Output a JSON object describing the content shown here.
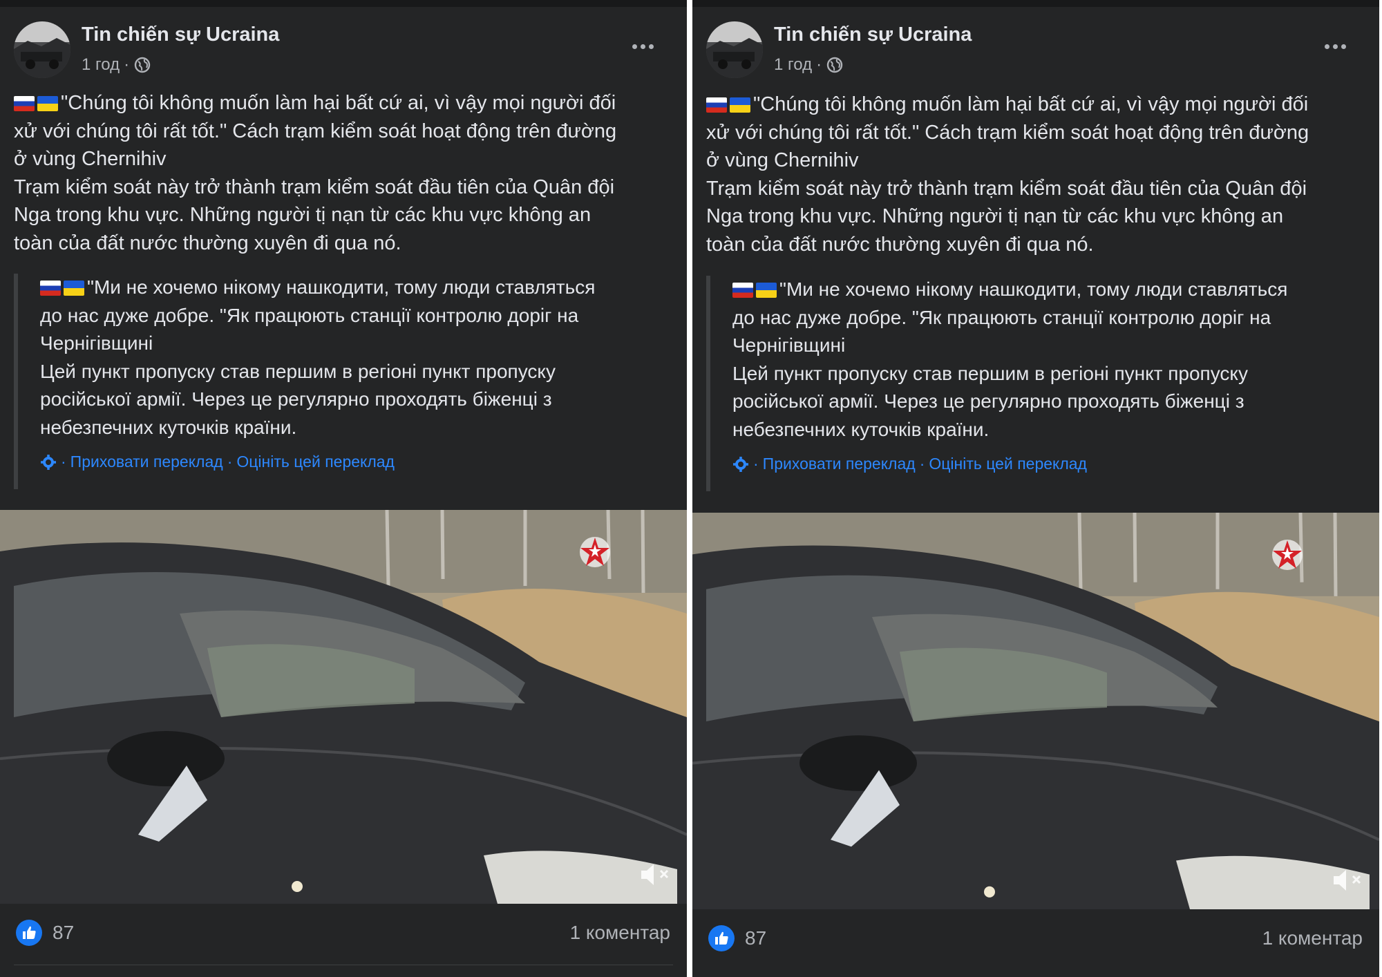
{
  "post": {
    "page_name": "Tin chiến sự Ucraina",
    "time": "1 год",
    "separator": "·",
    "text_lines": [
      "\"Chúng tôi không muốn làm hại bất cứ ai, vì vậy mọi người đối",
      "xử với chúng tôi rất tốt.\"  Cách trạm kiểm soát hoạt động trên đường",
      "ở vùng Chernihiv",
      " Trạm kiểm soát này trở thành trạm kiểm soát đầu tiên của Quân đội",
      "Nga trong khu vực.  Những người tị nạn từ các khu vực không an",
      "toàn của đất nước thường xuyên đi qua nó."
    ],
    "translation_lines": [
      "\"Ми не хочемо нікому нашкодити, тому люди ставляться",
      "до нас дуже добре. \"Як працюють станції контролю доріг на",
      "Чернігівщині",
      "Цей пункт пропуску став першим в регіоні пункт пропуску",
      "російської армії. Через це регулярно проходять біженці з",
      "небезпечних куточків країни."
    ],
    "hide_translation": "Приховати переклад",
    "rate_translation": "Оцініть цей переклад",
    "likes": "87",
    "comments": "1 коментар"
  },
  "colors": {
    "background": "#242526",
    "text": "#e4e6eb",
    "secondary_text": "#b0b3b8",
    "link": "#2d88ff",
    "like_blue": "#1877f2"
  },
  "icons": [
    "globe-icon",
    "more-icon",
    "gear-icon",
    "like-icon",
    "mute-icon",
    "star-logo-icon"
  ]
}
